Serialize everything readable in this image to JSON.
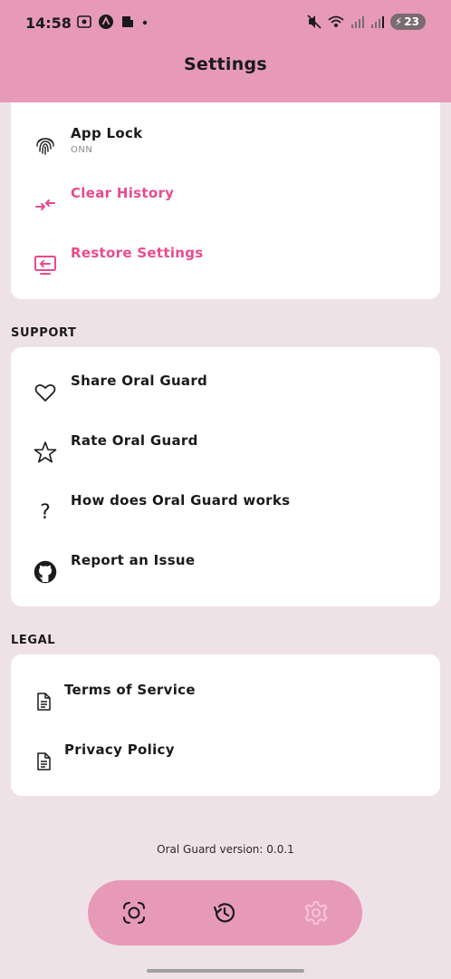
{
  "status_bar": {
    "time": "14:58",
    "battery": "23"
  },
  "header": {
    "title": "Settings"
  },
  "security_card": {
    "items": [
      {
        "label": "App Lock",
        "sub": "ONN",
        "icon": "fingerprint-icon"
      },
      {
        "label": "Clear History",
        "icon": "swap-arrows-icon"
      },
      {
        "label": "Restore Settings",
        "icon": "restore-screen-icon"
      }
    ]
  },
  "support": {
    "heading": "SUPPORT",
    "items": [
      {
        "label": "Share Oral Guard",
        "icon": "heart-icon"
      },
      {
        "label": "Rate Oral Guard",
        "icon": "star-icon"
      },
      {
        "label": "How does Oral Guard works",
        "icon": "question-icon"
      },
      {
        "label": "Report an Issue",
        "icon": "github-icon"
      }
    ]
  },
  "legal": {
    "heading": "LEGAL",
    "items": [
      {
        "label": "Terms of Service",
        "icon": "document-icon"
      },
      {
        "label": "Privacy Policy",
        "icon": "document-icon"
      }
    ]
  },
  "footer": {
    "version": "Oral Guard version: 0.0.1"
  },
  "bottom_nav": {
    "items": [
      {
        "name": "scan",
        "icon": "scan-icon",
        "active": false
      },
      {
        "name": "history",
        "icon": "history-icon",
        "active": false
      },
      {
        "name": "settings",
        "icon": "gear-icon",
        "active": true
      }
    ]
  },
  "colors": {
    "header": "#e79ab8",
    "accent": "#e84b8d",
    "background": "#efe2e6"
  }
}
